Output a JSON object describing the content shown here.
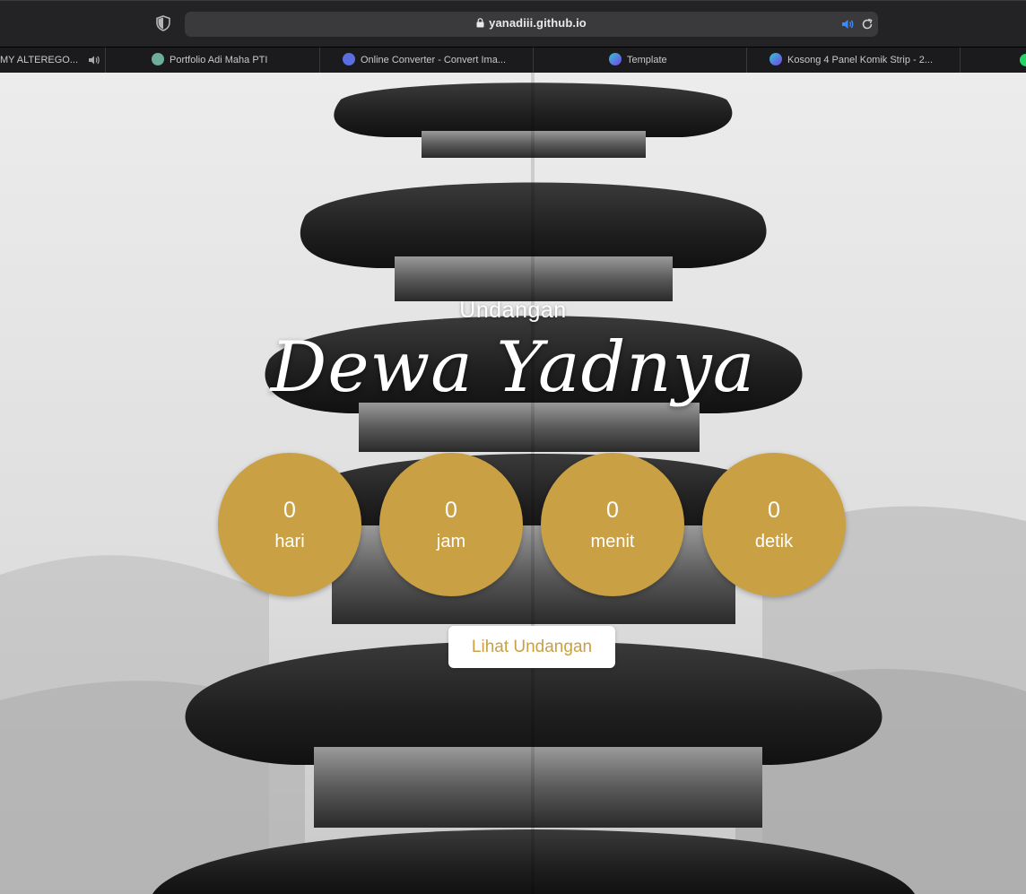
{
  "browser": {
    "url": "yanadiii.github.io",
    "tabs": [
      {
        "label": "MY ALTEREGO...",
        "favicon": "speaker-icon"
      },
      {
        "label": "Portfolio Adi Maha PTI",
        "favicon": "openai-icon"
      },
      {
        "label": "Online Converter - Convert Ima...",
        "favicon": "converter-icon"
      },
      {
        "label": "Template",
        "favicon": "canva-icon"
      },
      {
        "label": "Kosong 4 Panel Komik Strip - 2...",
        "favicon": "canva-icon"
      }
    ]
  },
  "hero": {
    "subtitle": "Undangan",
    "title": "Dewa Yadnya"
  },
  "countdown": [
    {
      "value": "0",
      "unit": "hari"
    },
    {
      "value": "0",
      "unit": "jam"
    },
    {
      "value": "0",
      "unit": "menit"
    },
    {
      "value": "0",
      "unit": "detik"
    }
  ],
  "cta": {
    "label": "Lihat Undangan"
  },
  "colors": {
    "accent_gold": "#c9a043",
    "toolbar_bg": "#232325",
    "urlbar_bg": "#3a3a3c"
  }
}
